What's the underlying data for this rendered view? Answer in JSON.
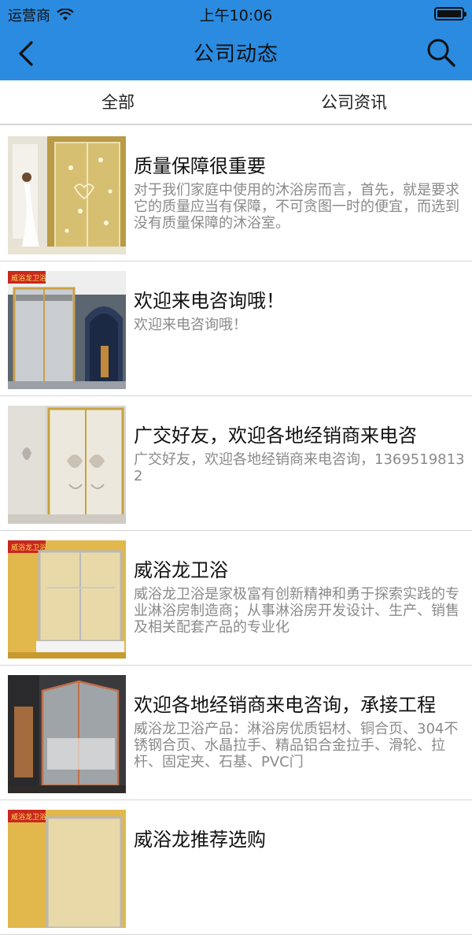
{
  "status_bar": {
    "carrier": "运营商",
    "time": "上午10:06"
  },
  "nav": {
    "title": "公司动态"
  },
  "tabs": [
    {
      "label": "全部"
    },
    {
      "label": "公司资讯"
    }
  ],
  "articles": [
    {
      "title": "质量保障很重要",
      "summary": "对于我们家庭中使用的沐浴房而言，首先，就是要求它的质量应当有保障，不可贪图一时的便宜，而选到没有质量保障的沐浴室。",
      "badge": ""
    },
    {
      "title": "欢迎来电咨询哦！",
      "summary": "欢迎来电咨询哦！",
      "badge": "威浴龙卫浴"
    },
    {
      "title": "广交好友，欢迎各地经销商来电咨",
      "summary": "广交好友，欢迎各地经销商来电咨询，13695198132",
      "badge": ""
    },
    {
      "title": "威浴龙卫浴",
      "summary": "威浴龙卫浴是家极富有创新精神和勇于探索实践的专业淋浴房制造商；从事淋浴房开发设计、生产、销售及相关配套产品的专业化",
      "badge": "威浴龙卫浴"
    },
    {
      "title": "欢迎各地经销商来电咨询，承接工程",
      "summary": "威浴龙卫浴产品：淋浴房优质铝材、铜合页、304不锈钢合页、水晶拉手、精品铝合金拉手、滑轮、拉杆、固定夹、石基、PVC门",
      "badge": ""
    },
    {
      "title": "威浴龙推荐选购",
      "summary": "",
      "badge": ""
    }
  ]
}
